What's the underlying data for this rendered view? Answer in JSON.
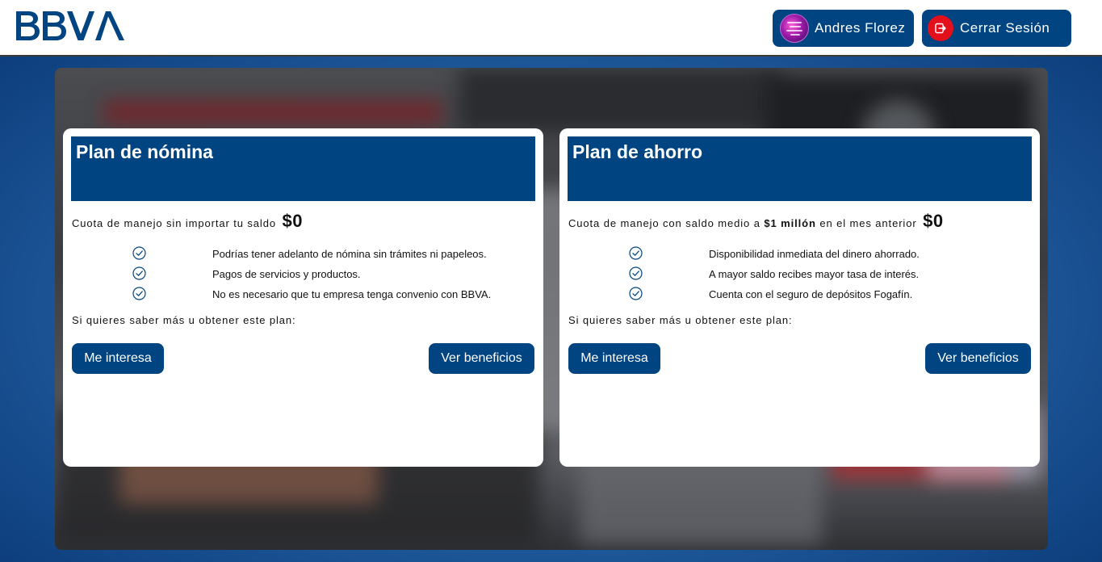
{
  "header": {
    "logo_text": "BBVA",
    "user": {
      "name": "Andres Florez"
    },
    "logout_label": "Cerrar Sesión"
  },
  "colors": {
    "brand": "#004481",
    "logout_icon_bg": "#e3101b",
    "background": "#1f5a9c"
  },
  "plans": [
    {
      "title": "Plan de nómina",
      "fee_text": "Cuota de manejo sin importar tu saldo",
      "fee_amount": "$0",
      "benefits": [
        "Podrías tener adelanto de nómina sin trámites ni papeleos.",
        "Pagos de servicios y productos.",
        "No es necesario que tu empresa tenga convenio con BBVA."
      ],
      "info_text": "Si quieres saber más u obtener este plan:",
      "interest_label": "Me interesa",
      "benefits_label": "Ver beneficios"
    },
    {
      "title": "Plan de ahorro",
      "fee_text_before": "Cuota de manejo con saldo medio a",
      "fee_text_bold": "$1 millón",
      "fee_text_after": "en el mes anterior",
      "fee_amount": "$0",
      "benefits": [
        "Disponibilidad inmediata del dinero ahorrado.",
        "A mayor saldo recibes mayor tasa de interés.",
        "Cuenta con el seguro de depósitos Fogafín."
      ],
      "info_text": "Si quieres saber más u obtener este plan:",
      "interest_label": "Me interesa",
      "benefits_label": "Ver beneficios"
    }
  ]
}
